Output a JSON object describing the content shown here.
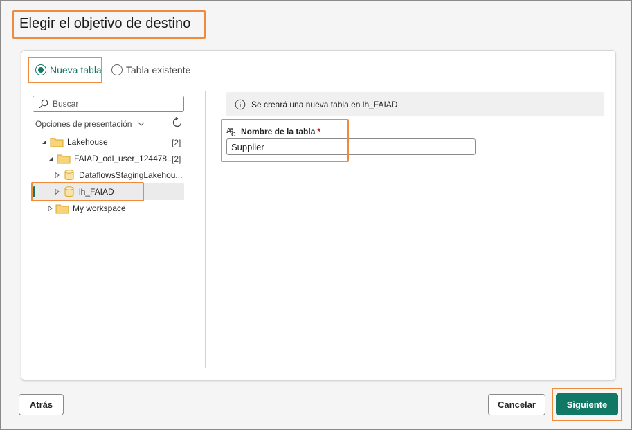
{
  "dialog": {
    "title": "Elegir el objetivo de destino"
  },
  "mode": {
    "new_table_label": "Nueva tabla",
    "existing_table_label": "Tabla existente",
    "selected": "Nueva tabla"
  },
  "navigator": {
    "search_placeholder": "Buscar",
    "view_options_label": "Opciones de presentación",
    "tree": [
      {
        "label": "Lakehouse",
        "count": "[2]",
        "expanded": true
      },
      {
        "label": "FAIAD_odl_user_124478...",
        "count": "[2]",
        "expanded": true
      },
      {
        "label": "DataflowsStagingLakehou...",
        "expanded": false
      },
      {
        "label": "lh_FAIAD",
        "expanded": false,
        "selected": true
      },
      {
        "label": "My workspace",
        "expanded": false
      }
    ]
  },
  "details": {
    "info_message": "Se creará una nueva tabla en lh_FAIAD",
    "table_name_label": "Nombre de la tabla",
    "required_marker": "*",
    "table_name_value": "Supplier"
  },
  "footer": {
    "back_label": "Atrás",
    "cancel_label": "Cancelar",
    "next_label": "Siguiente"
  },
  "colors": {
    "accent": "#117865",
    "highlight": "#f08a3c",
    "folder": "#f5c542"
  }
}
